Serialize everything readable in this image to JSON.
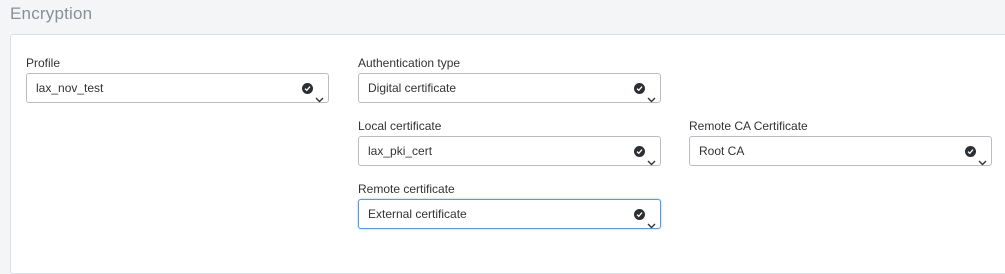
{
  "section": {
    "title": "Encryption"
  },
  "fields": {
    "profile": {
      "label": "Profile",
      "value": "lax_nov_test"
    },
    "authentication_type": {
      "label": "Authentication type",
      "value": "Digital certificate"
    },
    "local_certificate": {
      "label": "Local certificate",
      "value": "lax_pki_cert"
    },
    "remote_ca_certificate": {
      "label": "Remote CA Certificate",
      "value": "Root CA"
    },
    "remote_certificate": {
      "label": "Remote certificate",
      "value": "External certificate"
    }
  },
  "icons": {
    "select_status": "check-circle-icon",
    "select_toggle": "chevron-down-icon"
  }
}
